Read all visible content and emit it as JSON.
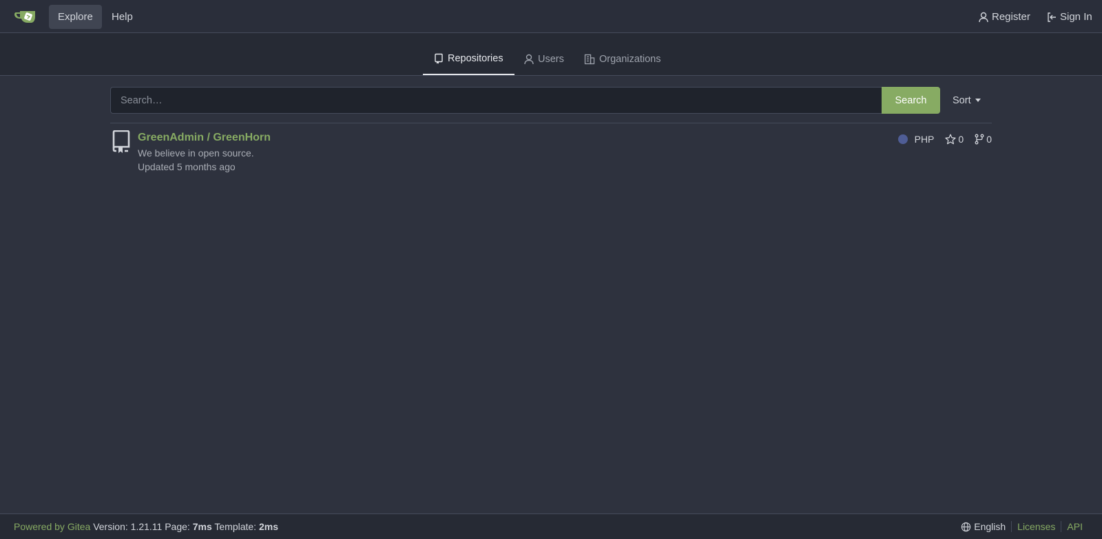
{
  "navbar": {
    "logo_icon": "gitea-teacup-logo-icon",
    "explore_label": "Explore",
    "help_label": "Help",
    "register_label": "Register",
    "signin_label": "Sign In"
  },
  "tabs": {
    "repositories": "Repositories",
    "users": "Users",
    "organizations": "Organizations"
  },
  "search": {
    "placeholder": "Search…",
    "button_label": "Search",
    "sort_label": "Sort"
  },
  "repos": [
    {
      "title": "GreenAdmin / GreenHorn",
      "description": "We believe in open source.",
      "updated": "Updated 5 months ago",
      "language": "PHP",
      "language_color": "#4f5d95",
      "stars": "0",
      "forks": "0"
    }
  ],
  "footer": {
    "powered_by": "Powered by Gitea",
    "version_text": "Version: 1.21.11 Page:",
    "page_time": "7ms",
    "template_label": "Template:",
    "template_time": "2ms",
    "language": "English",
    "licenses": "Licenses",
    "api": "API"
  },
  "colors": {
    "accent_green": "#87ab63",
    "background": "#2e323e",
    "navbar": "#2a2e3a"
  }
}
